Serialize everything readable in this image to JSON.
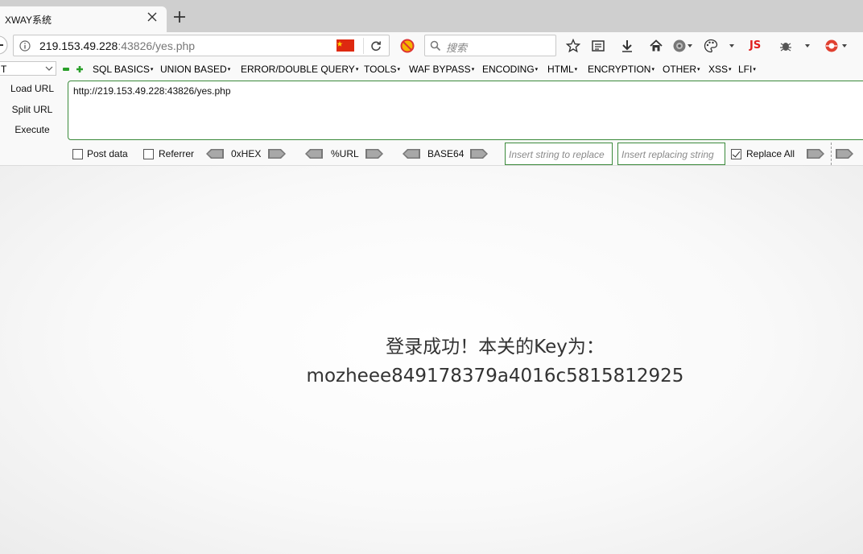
{
  "tab": {
    "title": "XWAY系统"
  },
  "urlbar": {
    "host": "219.153.49.228",
    "rest": ":43826/yes.php"
  },
  "search": {
    "placeholder": "搜索"
  },
  "toolbar": {
    "js_label": "JS"
  },
  "hackbar": {
    "select_value": "T",
    "menus": [
      "SQL BASICS",
      "UNION BASED",
      "ERROR/DOUBLE QUERY",
      "TOOLS",
      "WAF BYPASS",
      "ENCODING",
      "HTML",
      "ENCRYPTION",
      "OTHER",
      "XSS",
      "LFI"
    ],
    "load_url": "Load URL",
    "split_url": "Split URL",
    "execute": "Execute",
    "url_value": "http://219.153.49.228:43826/yes.php",
    "post_data": "Post data",
    "referrer": "Referrer",
    "hex": "0xHEX",
    "url_enc": "%URL",
    "base64": "BASE64",
    "replace_placeholder": "Insert string to replace",
    "replacing_placeholder": "Insert replacing string",
    "replace_all": "Replace All",
    "post_data_checked": false,
    "referrer_checked": false,
    "replace_all_checked": true
  },
  "page": {
    "line1": "登录成功！本关的Key为：",
    "line2": "mozheee849178379a4016c5815812925"
  }
}
